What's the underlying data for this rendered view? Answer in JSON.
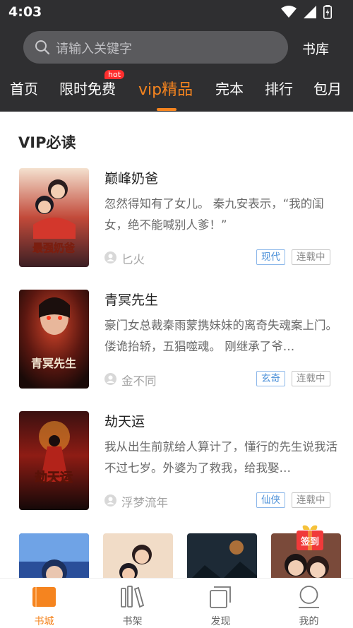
{
  "status": {
    "time": "4:03"
  },
  "search": {
    "placeholder": "请输入关键字",
    "library_label": "书库"
  },
  "tabs": [
    {
      "label": "首页"
    },
    {
      "label": "限时免费",
      "badge": "hot"
    },
    {
      "label": "vip精品",
      "active": true
    },
    {
      "label": "完本"
    },
    {
      "label": "排行"
    },
    {
      "label": "包月"
    }
  ],
  "section": {
    "title": "VIP必读"
  },
  "books": [
    {
      "title": "巅峰奶爸",
      "desc": "忽然得知有了女儿。 秦九安表示，“我的闺女，绝不能喊别人爹！”",
      "author": "匕火",
      "genre": "现代",
      "status": "连载中",
      "cover_text": "最强奶爸"
    },
    {
      "title": "青冥先生",
      "desc": "豪门女总裁秦雨蒙携妹妹的离奇失魂案上门。 偻诡抬轿，五猖噬魂。 刚继承了爷…",
      "author": "金不同",
      "genre": "玄奇",
      "status": "连载中",
      "cover_text": "青冥先生"
    },
    {
      "title": "劫天运",
      "desc": "我从出生前就给人算计了，懂行的先生说我活不过七岁。外婆为了救我，给我娶…",
      "author": "浮梦流年",
      "genre": "仙侠",
      "status": "连载中",
      "cover_text": "劫天运"
    }
  ],
  "checkin": {
    "label": "签到"
  },
  "bottom_nav": [
    {
      "label": "书城",
      "active": true
    },
    {
      "label": "书架"
    },
    {
      "label": "发现"
    },
    {
      "label": "我的"
    }
  ],
  "colors": {
    "accent": "#f5841f",
    "header_bg": "#2f2f31",
    "tag_blue": "#4a8fd8"
  }
}
